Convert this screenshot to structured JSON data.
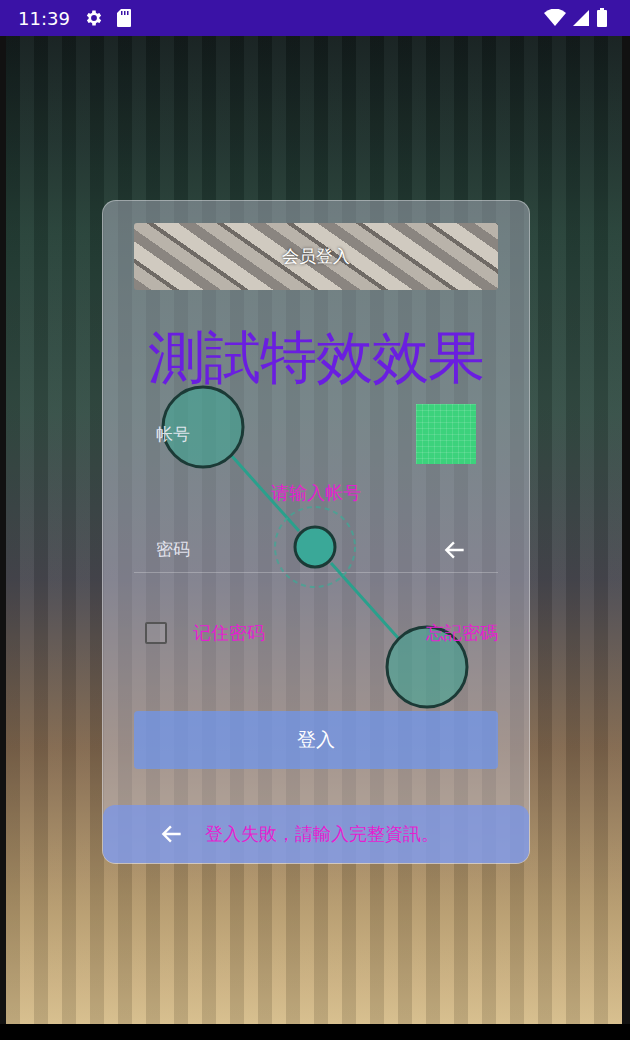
{
  "status_bar": {
    "time": "11:39"
  },
  "header": {
    "title": "会员登入"
  },
  "effect_title": "測試特效效果",
  "username": {
    "label": "帐号",
    "hint": "请输入帐号"
  },
  "password": {
    "label": "密码"
  },
  "remember": {
    "label": "记住密码",
    "checked": false
  },
  "forgot": "忘記密碼",
  "login_button": "登入",
  "message": {
    "text": "登入失敗，請輸入完整資訊。"
  }
}
